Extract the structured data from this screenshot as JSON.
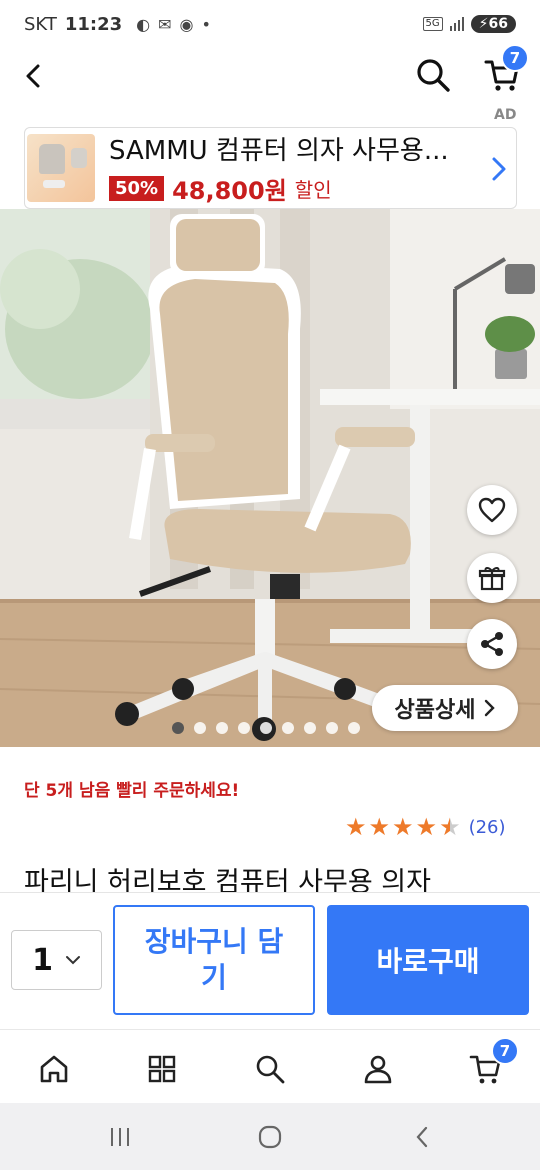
{
  "status_bar": {
    "carrier": "SKT",
    "time": "11:23",
    "network": "5G",
    "battery": "66"
  },
  "top_bar": {
    "cart_count": "7"
  },
  "ad": {
    "label": "AD",
    "title": "SAMMU 컴퓨터 의자 사무용...",
    "discount": "50%",
    "price": "48,800원",
    "sale_label": "할인"
  },
  "product_image": {
    "detail_label": "상품상세",
    "slide_count": 9,
    "active_slide": 1
  },
  "product": {
    "stock_notice": "단 5개 남음 빨리 주문하세요!",
    "rating": 4.5,
    "review_count": "(26)",
    "title": "파리니 허리보호 컴퓨터 사무용 의자"
  },
  "purchase": {
    "quantity": "1",
    "add_to_cart": "장바구니 담기",
    "buy_now": "바로구매"
  },
  "bottom_nav": {
    "cart_count": "7"
  },
  "colors": {
    "accent": "#3478f6",
    "sale_red": "#c81e1e",
    "star": "#ee7a2a"
  }
}
